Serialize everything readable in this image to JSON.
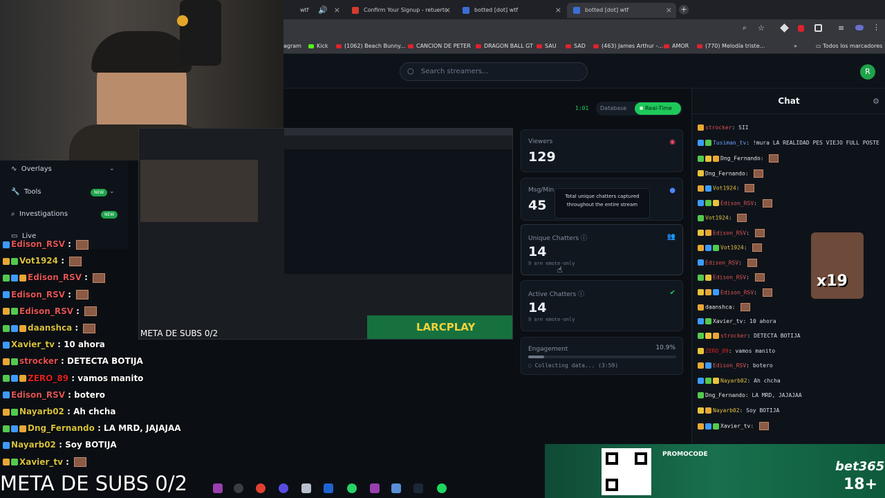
{
  "browser": {
    "tabs": [
      {
        "label": "wtf"
      },
      {
        "label": "Confirm Your Signup - retuerto"
      },
      {
        "label": "botted [dot] wtf"
      },
      {
        "label": "botted [dot] wtf"
      }
    ],
    "bookmarks": [
      "agram",
      "Kick",
      "(1062) Beach Bunny...",
      "CANCION DE PETER",
      "DRAGON BALL GT",
      "SAU",
      "SAD",
      "(463) James Arthur -...",
      "AMOR",
      "(770) Melodía triste..."
    ],
    "bookmarks_all": "Todos los marcadores"
  },
  "header": {
    "search_placeholder": "Search streamers...",
    "avatar_letter": "R"
  },
  "sidebar": {
    "items": [
      {
        "label": "Overlays"
      },
      {
        "label": "Tools",
        "badge": "NEW"
      },
      {
        "label": "Investigations",
        "badge": "NEW"
      },
      {
        "label": "Live"
      }
    ]
  },
  "mode": {
    "timer": "1:01",
    "database": "Database",
    "realtime": "Real-Time"
  },
  "stats": {
    "viewers": {
      "title": "Viewers",
      "value": "129"
    },
    "msg_min": {
      "title": "Msg/Min",
      "value": "45",
      "tooltip": "Total unique chatters captured throughout the entire stream"
    },
    "unique": {
      "title": "Unique Chatters",
      "value": "14",
      "sub": "9 are emote-only"
    },
    "active": {
      "title": "Active Chatters",
      "value": "14",
      "sub": "9 are emote-only"
    },
    "engagement": {
      "title": "Engagement",
      "value": "10.9%",
      "progress": 0.109,
      "sub": "Collecting data... (3:59)"
    }
  },
  "chat": {
    "title": "Chat",
    "messages": [
      {
        "user": "strocker",
        "text": "SII",
        "color": "#e05050"
      },
      {
        "user": "Tusiman_tv",
        "text": "!mura LA REALIDAD PES VIEJO FULL POSTE",
        "color": "#6aa0ff"
      },
      {
        "user": "Dng_Fernando",
        "text": "",
        "color": "#e8e8e8"
      },
      {
        "user": "Dng_Fernando",
        "text": "",
        "color": "#e8e8e8"
      },
      {
        "user": "Vot1924",
        "text": "",
        "color": "#e0c040"
      },
      {
        "user": "Edison_RSV",
        "text": "",
        "color": "#e05555"
      },
      {
        "user": "Vot1924",
        "text": "",
        "color": "#e0c040"
      },
      {
        "user": "Edison_RSV",
        "text": "",
        "color": "#e05555"
      },
      {
        "user": "Vot1924",
        "text": "",
        "color": "#e0c040"
      },
      {
        "user": "Edison_RSV",
        "text": "",
        "color": "#e05555"
      },
      {
        "user": "Edison_RSV",
        "text": "",
        "color": "#e05555"
      },
      {
        "user": "Edison_RSV",
        "text": "",
        "color": "#e05555"
      },
      {
        "user": "daanshca",
        "text": "",
        "color": "#e8e8e8"
      },
      {
        "user": "Xavier_tv",
        "text": "10 ahora",
        "color": "#e8e8e8"
      },
      {
        "user": "strocker",
        "text": "DETECTA BOTIJA",
        "color": "#e05050"
      },
      {
        "user": "ZERO_89",
        "text": "vamos manito",
        "color": "#e02020"
      },
      {
        "user": "Edison_RSV",
        "text": "botero",
        "color": "#e05555"
      },
      {
        "user": "Nayarb02",
        "text": "Ah chcha",
        "color": "#e0c040"
      },
      {
        "user": "Dng_Fernando",
        "text": "LA MRD, JAJAJAA",
        "color": "#e8e8e8"
      },
      {
        "user": "Nayarb02",
        "text": "Soy BOTIJA",
        "color": "#e0c040"
      },
      {
        "user": "Xavier_tv",
        "text": "",
        "color": "#e8e8e8"
      }
    ],
    "emote_label": "x19"
  },
  "overlay": {
    "messages": [
      {
        "user": "Edison_RSV",
        "text": "",
        "color": "#e05555"
      },
      {
        "user": "Vot1924",
        "text": "",
        "color": "#d6c140"
      },
      {
        "user": "Edison_RSV",
        "text": "",
        "color": "#e05555"
      },
      {
        "user": "Edison_RSV",
        "text": "",
        "color": "#e05555"
      },
      {
        "user": "Edison_RSV",
        "text": "",
        "color": "#e05555"
      },
      {
        "user": "daanshca",
        "text": "",
        "color": "#d6c140"
      },
      {
        "user": "Xavier_tv",
        "text": "10 ahora",
        "color": "#d6c140"
      },
      {
        "user": "strocker",
        "text": "DETECTA BOTIJA",
        "color": "#e05050"
      },
      {
        "user": "ZERO_89",
        "text": "vamos manito",
        "color": "#e02020"
      },
      {
        "user": "Edison_RSV",
        "text": "botero",
        "color": "#e05555"
      },
      {
        "user": "Nayarb02",
        "text": "Ah chcha",
        "color": "#d6c140"
      },
      {
        "user": "Dng_Fernando",
        "text": "LA MRD, JAJAJAA",
        "color": "#d6c140"
      },
      {
        "user": "Nayarb02",
        "text": "Soy BOTIJA",
        "color": "#d6c140"
      },
      {
        "user": "Xavier_tv",
        "text": "",
        "color": "#d6c140"
      }
    ],
    "meta_subs": "META DE SUBS 0/2",
    "preview_meta": "META DE SUBS 0/2",
    "preview_brand": "LARCPLAY"
  },
  "ad": {
    "promocode": "PROMOCODE",
    "brand": "bet365",
    "age": "18+"
  }
}
